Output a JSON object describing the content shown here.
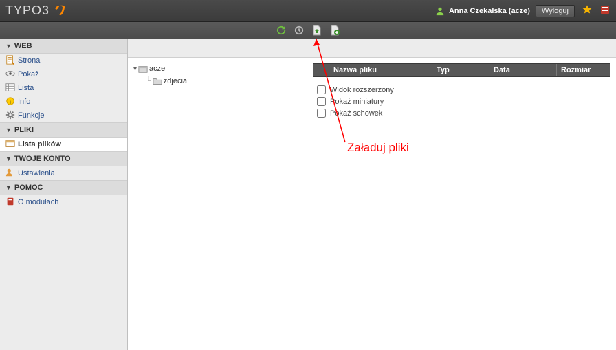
{
  "header": {
    "product": "TYPO3",
    "user_display": "Anna Czekalska (acze)",
    "logout_label": "Wyloguj"
  },
  "nav": {
    "groups": [
      {
        "label": "WEB",
        "items": [
          {
            "id": "page",
            "label": "Strona",
            "icon": "page-icon"
          },
          {
            "id": "view",
            "label": "Pokaż",
            "icon": "eye-icon"
          },
          {
            "id": "list",
            "label": "Lista",
            "icon": "list-icon"
          },
          {
            "id": "info",
            "label": "Info",
            "icon": "info-icon"
          },
          {
            "id": "func",
            "label": "Funkcje",
            "icon": "gear-icon"
          }
        ]
      },
      {
        "label": "PLIKI",
        "items": [
          {
            "id": "filelist",
            "label": "Lista plików",
            "icon": "filelist-icon",
            "active": true
          }
        ]
      },
      {
        "label": "TWOJE KONTO",
        "items": [
          {
            "id": "setup",
            "label": "Ustawienia",
            "icon": "user-settings-icon"
          }
        ]
      },
      {
        "label": "POMOC",
        "items": [
          {
            "id": "about",
            "label": "O modułach",
            "icon": "book-icon"
          }
        ]
      }
    ]
  },
  "tree": {
    "root_label": "acze",
    "child_label": "zdjecia"
  },
  "filelist": {
    "columns": {
      "name": "Nazwa pliku",
      "type": "Typ",
      "date": "Data",
      "size": "Rozmiar"
    },
    "options": {
      "extended_view": "Widok rozszerzony",
      "show_thumbs": "Pokaż miniatury",
      "show_clipboard": "Pokaż schowek"
    }
  },
  "annotation": {
    "label": "Załaduj pliki"
  }
}
